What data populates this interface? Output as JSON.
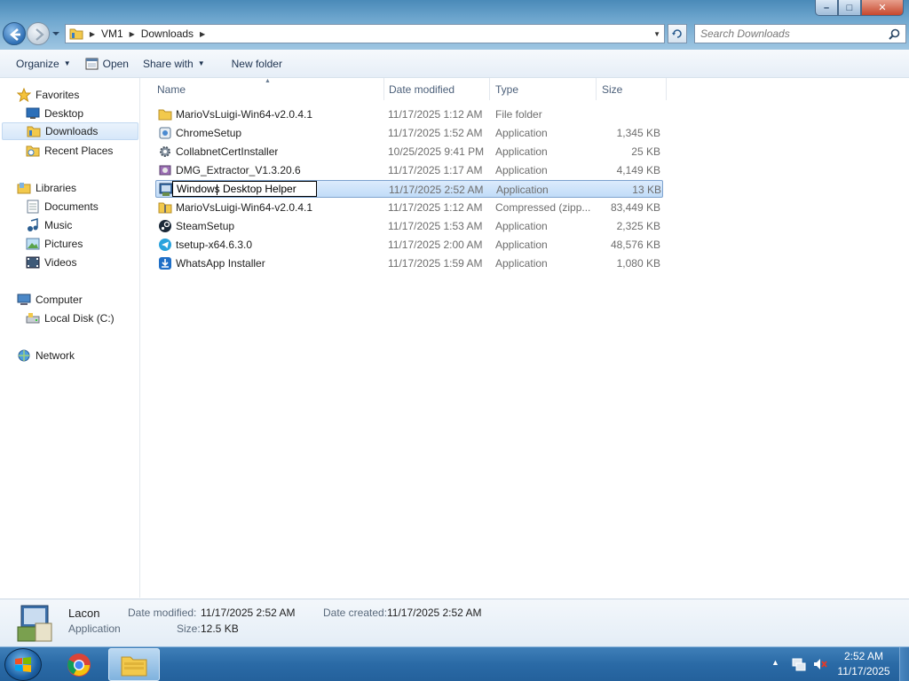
{
  "window": {
    "search_placeholder": "Search Downloads",
    "breadcrumbs": [
      "VM1",
      "Downloads"
    ],
    "controls": {
      "minimize": "–",
      "maximize": "□",
      "close": "✕"
    }
  },
  "toolbar": {
    "organize": "Organize",
    "open": "Open",
    "share_with": "Share with",
    "new_folder": "New folder",
    "help": "?"
  },
  "nav": {
    "favorites": "Favorites",
    "desktop": "Desktop",
    "downloads": "Downloads",
    "recent_places": "Recent Places",
    "libraries": "Libraries",
    "documents": "Documents",
    "music": "Music",
    "pictures": "Pictures",
    "videos": "Videos",
    "computer": "Computer",
    "local_disk": "Local Disk (C:)",
    "network": "Network"
  },
  "columns": {
    "name": "Name",
    "date_modified": "Date modified",
    "type": "Type",
    "size": "Size"
  },
  "files": [
    {
      "name": "MarioVsLuigi-Win64-v2.0.4.1",
      "date": "11/17/2025 1:12 AM",
      "type": "File folder",
      "size": "",
      "icon": "folder-icon"
    },
    {
      "name": "ChromeSetup",
      "date": "11/17/2025 1:52 AM",
      "type": "Application",
      "size": "1,345 KB",
      "icon": "installer-icon"
    },
    {
      "name": "CollabnetCertInstaller",
      "date": "10/25/2025 9:41 PM",
      "type": "Application",
      "size": "25 KB",
      "icon": "gear-app-icon"
    },
    {
      "name": "DMG_Extractor_V1.3.20.6",
      "date": "11/17/2025 1:17 AM",
      "type": "Application",
      "size": "4,149 KB",
      "icon": "disk-app-icon"
    },
    {
      "name": "Windows Desktop Helper",
      "date": "11/17/2025 2:52 AM",
      "type": "Application",
      "size": "13 KB",
      "icon": "setup-app-icon"
    },
    {
      "name": "MarioVsLuigi-Win64-v2.0.4.1",
      "date": "11/17/2025 1:12 AM",
      "type": "Compressed (zipp...",
      "size": "83,449 KB",
      "icon": "zip-folder-icon"
    },
    {
      "name": "SteamSetup",
      "date": "11/17/2025 1:53 AM",
      "type": "Application",
      "size": "2,325 KB",
      "icon": "steam-icon"
    },
    {
      "name": "tsetup-x64.6.3.0",
      "date": "11/17/2025 2:00 AM",
      "type": "Application",
      "size": "48,576 KB",
      "icon": "telegram-icon"
    },
    {
      "name": "WhatsApp Installer",
      "date": "11/17/2025 1:59 AM",
      "type": "Application",
      "size": "1,080 KB",
      "icon": "download-app-icon"
    }
  ],
  "details": {
    "name": "Lacon",
    "type": "Application",
    "date_modified_label": "Date modified:",
    "date_modified": "11/17/2025 2:52 AM",
    "date_created_label": "Date created:",
    "date_created": "11/17/2025 2:52 AM",
    "size_label": "Size:",
    "size": "12.5 KB"
  },
  "taskbar": {
    "time": "2:52 AM",
    "date": "11/17/2025"
  },
  "colors": {
    "selection": "#cce4fa",
    "taskbar": "#2a6aa6",
    "titlebar": "#6fa7cf"
  }
}
